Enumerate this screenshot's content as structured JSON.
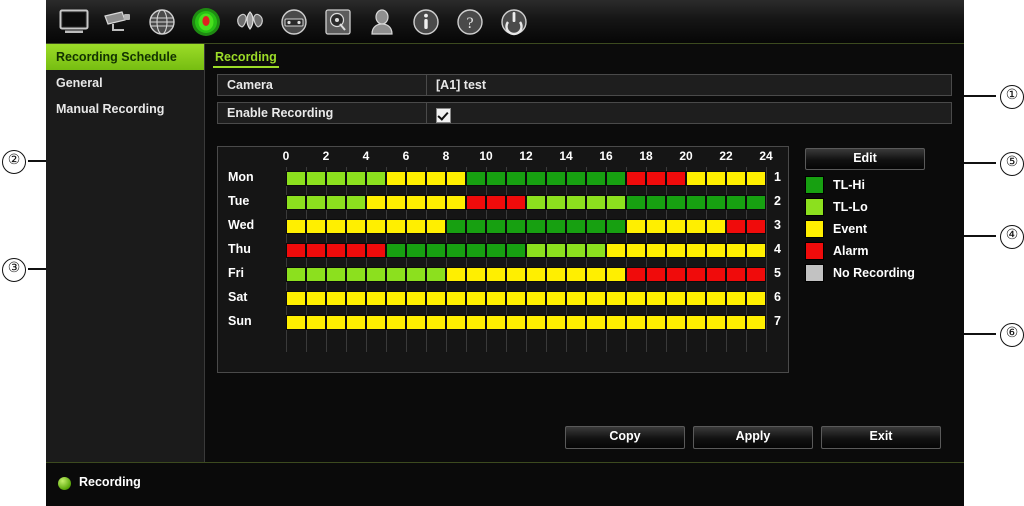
{
  "toolbar": {
    "icons": [
      {
        "name": "monitor-icon",
        "active": false
      },
      {
        "name": "camera-icon",
        "active": false
      },
      {
        "name": "network-globe-icon",
        "active": false
      },
      {
        "name": "record-icon",
        "active": true
      },
      {
        "name": "alarm-bell-icon",
        "active": false
      },
      {
        "name": "playback-icon",
        "active": false
      },
      {
        "name": "hard-disk-icon",
        "active": false
      },
      {
        "name": "user-icon",
        "active": false
      },
      {
        "name": "info-icon",
        "active": false
      },
      {
        "name": "help-icon",
        "active": false
      },
      {
        "name": "power-shutdown-icon",
        "active": false
      }
    ]
  },
  "sidebar": {
    "items": [
      {
        "label": "Recording Schedule",
        "active": true
      },
      {
        "label": "General",
        "active": false
      },
      {
        "label": "Manual Recording",
        "active": false
      }
    ]
  },
  "tabs": [
    {
      "label": "Recording",
      "active": true
    }
  ],
  "form": {
    "camera": {
      "label": "Camera",
      "value": "[A1] test"
    },
    "enable_recording": {
      "label": "Enable Recording",
      "checked": true
    }
  },
  "schedule": {
    "hour_ticks": [
      "0",
      "2",
      "4",
      "6",
      "8",
      "10",
      "12",
      "14",
      "16",
      "18",
      "20",
      "22",
      "24"
    ],
    "hour_min": 0,
    "hour_max": 24,
    "days": [
      {
        "label": "Mon",
        "number": "1",
        "segments": [
          {
            "start": 0,
            "end": 5,
            "type": "TL-Lo"
          },
          {
            "start": 5,
            "end": 9,
            "type": "Event"
          },
          {
            "start": 9,
            "end": 17,
            "type": "TL-Hi"
          },
          {
            "start": 17,
            "end": 20,
            "type": "Alarm"
          },
          {
            "start": 20,
            "end": 24,
            "type": "Event"
          }
        ]
      },
      {
        "label": "Tue",
        "number": "2",
        "segments": [
          {
            "start": 0,
            "end": 4,
            "type": "TL-Lo"
          },
          {
            "start": 4,
            "end": 9,
            "type": "Event"
          },
          {
            "start": 9,
            "end": 12,
            "type": "Alarm"
          },
          {
            "start": 12,
            "end": 17,
            "type": "TL-Lo"
          },
          {
            "start": 17,
            "end": 24,
            "type": "TL-Hi"
          }
        ]
      },
      {
        "label": "Wed",
        "number": "3",
        "segments": [
          {
            "start": 0,
            "end": 8,
            "type": "Event"
          },
          {
            "start": 8,
            "end": 17,
            "type": "TL-Hi"
          },
          {
            "start": 17,
            "end": 22,
            "type": "Event"
          },
          {
            "start": 22,
            "end": 24,
            "type": "Alarm"
          }
        ]
      },
      {
        "label": "Thu",
        "number": "4",
        "segments": [
          {
            "start": 0,
            "end": 5,
            "type": "Alarm"
          },
          {
            "start": 5,
            "end": 12,
            "type": "TL-Hi"
          },
          {
            "start": 12,
            "end": 16,
            "type": "TL-Lo"
          },
          {
            "start": 16,
            "end": 24,
            "type": "Event"
          }
        ]
      },
      {
        "label": "Fri",
        "number": "5",
        "segments": [
          {
            "start": 0,
            "end": 8,
            "type": "TL-Lo"
          },
          {
            "start": 8,
            "end": 17,
            "type": "Event"
          },
          {
            "start": 17,
            "end": 24,
            "type": "Alarm"
          }
        ]
      },
      {
        "label": "Sat",
        "number": "6",
        "segments": [
          {
            "start": 0,
            "end": 24,
            "type": "Event"
          }
        ]
      },
      {
        "label": "Sun",
        "number": "7",
        "segments": [
          {
            "start": 0,
            "end": 24,
            "type": "Event"
          }
        ]
      }
    ]
  },
  "edit_button": {
    "label": "Edit"
  },
  "legend": {
    "items": [
      {
        "label": "TL-Hi",
        "color": "#17a011"
      },
      {
        "label": "TL-Lo",
        "color": "#8ce01e"
      },
      {
        "label": "Event",
        "color": "#ffef00"
      },
      {
        "label": "Alarm",
        "color": "#f00b0b"
      },
      {
        "label": "No Recording",
        "color": "#c2c2c2"
      }
    ]
  },
  "buttons": [
    {
      "label": "Copy"
    },
    {
      "label": "Apply"
    },
    {
      "label": "Exit"
    }
  ],
  "status": {
    "label": "Recording",
    "color": "#79c41a"
  },
  "callouts": [
    {
      "id": "1",
      "label": "①"
    },
    {
      "id": "2",
      "label": "②"
    },
    {
      "id": "3",
      "label": "③"
    },
    {
      "id": "4",
      "label": "④"
    },
    {
      "id": "5",
      "label": "⑤"
    },
    {
      "id": "6",
      "label": "⑥"
    }
  ],
  "colors": {
    "TL-Hi": "#17a011",
    "TL-Lo": "#8ce01e",
    "Event": "#ffef00",
    "Alarm": "#f00b0b",
    "No Recording": "#c2c2c2",
    "accent": "#9cdc28"
  }
}
